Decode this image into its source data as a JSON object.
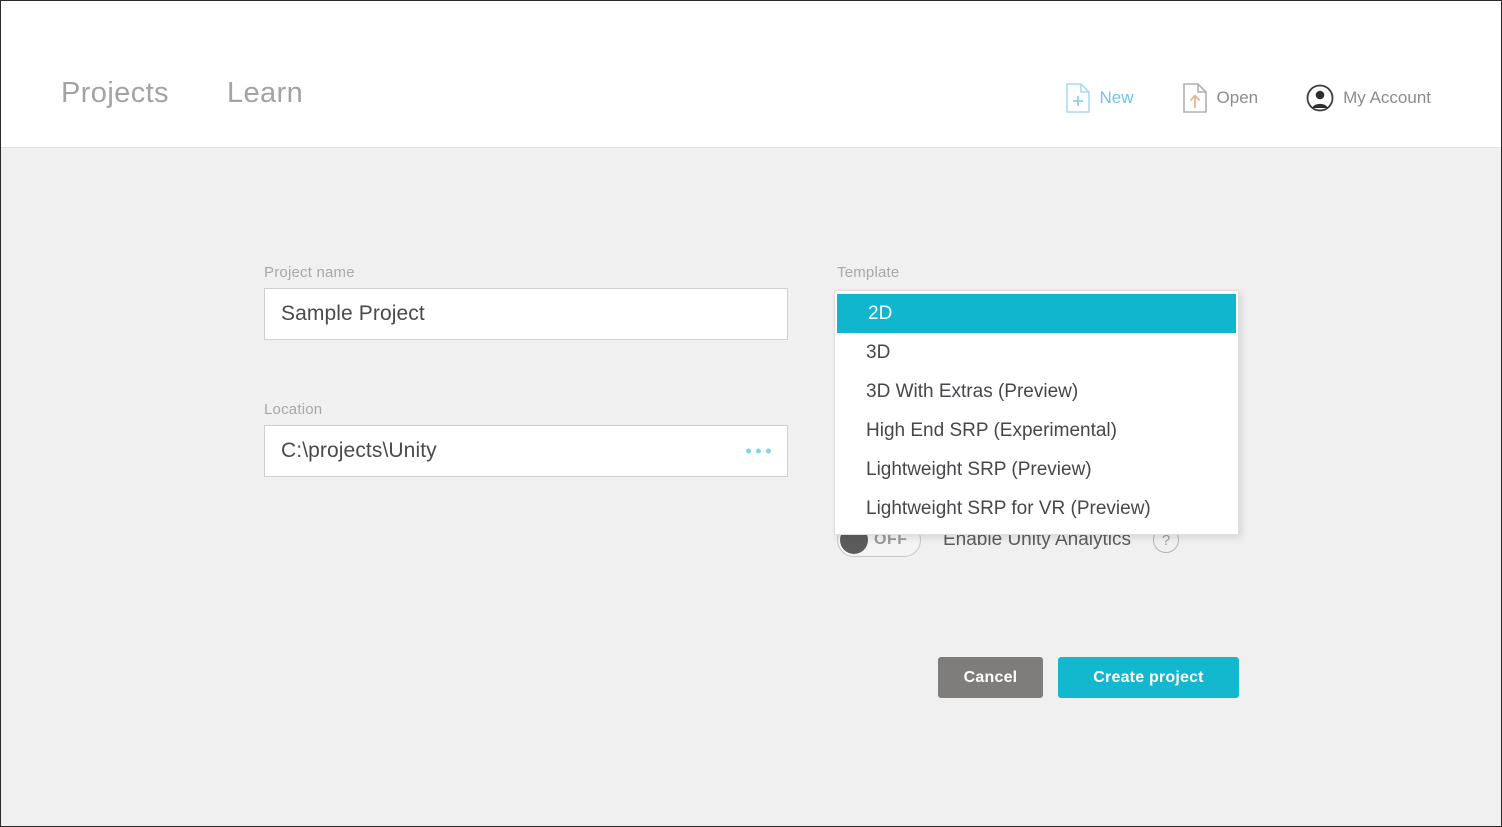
{
  "header": {
    "tabs": [
      {
        "label": "Projects",
        "name": "tab-projects"
      },
      {
        "label": "Learn",
        "name": "tab-learn"
      }
    ],
    "actions": [
      {
        "label": "New",
        "icon": "new-document-icon"
      },
      {
        "label": "Open",
        "icon": "open-document-icon"
      },
      {
        "label": "My Account",
        "icon": "account-avatar-icon"
      }
    ]
  },
  "form": {
    "project_name": {
      "label": "Project name",
      "value": "Sample Project"
    },
    "location": {
      "label": "Location",
      "value": "C:\\projects\\Unity",
      "browse_icon": "ellipsis-icon"
    },
    "template": {
      "label": "Template",
      "selected": "2D",
      "options": [
        "2D",
        "3D",
        "3D With Extras (Preview)",
        "High End SRP (Experimental)",
        "Lightweight SRP (Preview)",
        "Lightweight SRP for VR (Preview)"
      ]
    },
    "analytics": {
      "toggle_state": "OFF",
      "label": "Enable Unity Analytics",
      "help_glyph": "?"
    }
  },
  "buttons": {
    "cancel": "Cancel",
    "create": "Create project"
  },
  "colors": {
    "accent": "#10b6cd",
    "cancel_gray": "#7f7c7c",
    "body_bg": "#f0f0f0",
    "link_blue": "#6ec6e6"
  }
}
